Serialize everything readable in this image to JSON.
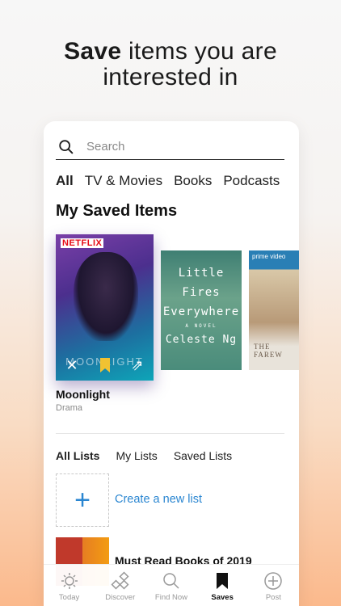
{
  "headline": {
    "bold": "Save",
    "rest1": " items you are",
    "rest2": "interested in"
  },
  "search": {
    "placeholder": "Search"
  },
  "filters": [
    "All",
    "TV & Movies",
    "Books",
    "Podcasts"
  ],
  "section_title": "My Saved Items",
  "saved_items": [
    {
      "title": "Moonlight",
      "genre": "Drama",
      "badge": "NETFLIX",
      "poster_text": "MOONLIGHT"
    },
    {
      "poster_text": "Little Fires Everywhere",
      "author": "Celeste Ng",
      "sub": "A NOVEL"
    },
    {
      "poster_badge": "prime video",
      "poster_text": "THE FAREW"
    }
  ],
  "list_tabs": [
    "All Lists",
    "My Lists",
    "Saved Lists"
  ],
  "create_list": {
    "label": "Create a new list",
    "icon": "+"
  },
  "lists": [
    {
      "name": "Must Read Books of 2019"
    }
  ],
  "tabbar": [
    {
      "label": "Today",
      "icon": "sun-icon"
    },
    {
      "label": "Discover",
      "icon": "discover-icon"
    },
    {
      "label": "Find Now",
      "icon": "search-icon"
    },
    {
      "label": "Saves",
      "icon": "bookmark-icon",
      "active": true
    },
    {
      "label": "Post",
      "icon": "plus-circle-icon"
    }
  ],
  "colors": {
    "accent": "#2a86d1",
    "bookmark": "#f1c232",
    "netflix": "#e50914"
  }
}
